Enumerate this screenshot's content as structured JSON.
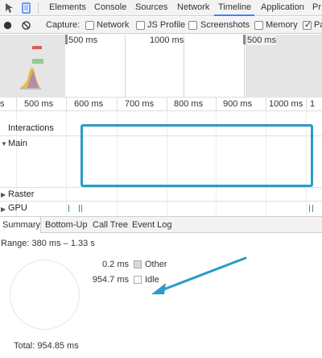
{
  "tabs": [
    "Elements",
    "Console",
    "Sources",
    "Network",
    "Timeline",
    "Application",
    "Pr"
  ],
  "active_tab": "Timeline",
  "toolbar": {
    "capture_label": "Capture:",
    "options": [
      {
        "label": "Network",
        "checked": false
      },
      {
        "label": "JS Profile",
        "checked": false
      },
      {
        "label": "Screenshots",
        "checked": false
      },
      {
        "label": "Memory",
        "checked": false
      },
      {
        "label": "Pa",
        "checked": true
      }
    ]
  },
  "overview": {
    "left_label": "500 ms",
    "mid_label": "1000 ms",
    "right_label": "500 ms"
  },
  "ruler": {
    "labels": [
      "s",
      "500 ms",
      "600 ms",
      "700 ms",
      "800 ms",
      "900 ms",
      "1000 ms",
      "1"
    ]
  },
  "tracks": {
    "interactions": "Interactions",
    "main": "Main",
    "raster": "Raster",
    "gpu": "GPU"
  },
  "summary_tabs": [
    "Summary",
    "Bottom-Up",
    "Call Tree",
    "Event Log"
  ],
  "active_summary_tab": "Summary",
  "summary": {
    "range": "Range: 380 ms – 1.33 s",
    "legend": [
      {
        "value": "0.2 ms",
        "name": "Other",
        "color": "#d9d9d9"
      },
      {
        "value": "954.7 ms",
        "name": "Idle",
        "color": "#ffffff"
      }
    ],
    "total": "Total: 954.85 ms"
  },
  "colors": {
    "accent": "#3e82f7",
    "highlight": "#2a9bc6",
    "gpu": "#3ea03e"
  }
}
